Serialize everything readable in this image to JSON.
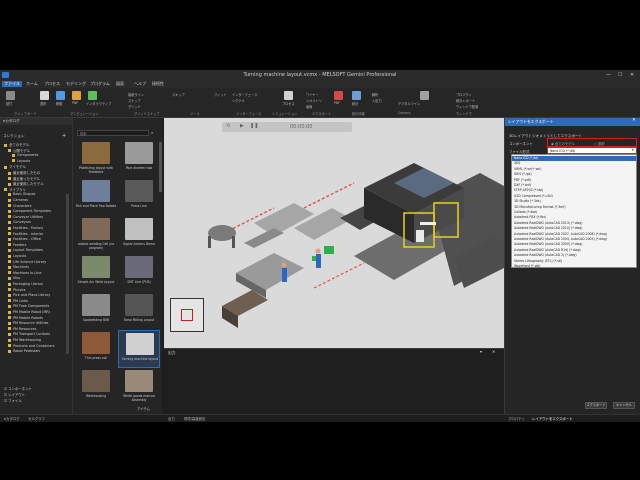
{
  "window": {
    "title": "Turning machine layout.vcmx - MELSOFT Gemini Professional"
  },
  "menu": [
    "ファイル",
    "ホーム",
    "プロセス",
    "モデリング",
    "プログラム",
    "図面",
    "ヘルプ",
    "接続性"
  ],
  "ribbon": {
    "groups": [
      "クリップボード",
      "マニピュレーション",
      "グリッドスナップ",
      "ツール",
      "インターフェース",
      "シミュレーション",
      "エクスポート",
      "統計情報",
      "Camera",
      "ウィンドウ"
    ],
    "items": [
      "貼付",
      "選択",
      "移動",
      "PNP",
      "インタラクティブ",
      "接続ライン",
      "スナップ",
      "グリッド",
      "スキップ",
      "インターフェース",
      "シグナル",
      "フィット",
      "プロセス",
      "ワイヤー",
      "ジオメトリ",
      "画像",
      "PDF",
      "統計",
      "解析",
      "入出力",
      "デジタルツイン",
      "エクスポート",
      "プロパティ",
      "統計レポート",
      "ウィンドウ配置"
    ]
  },
  "left_panel": {
    "title": "eカタログ",
    "collections_label": "コレクション",
    "tree": [
      "全てのモデル",
      "公開モデル",
      "Components",
      "Layouts",
      "マイモデル",
      "最近使用したもの",
      "最近使ったモデル",
      "最近使用したモデル",
      "ライブラリ",
      "Basic Shapes",
      "Cameras",
      "Characters",
      "Component Templates",
      "Conveyor Utilities",
      "Conveyors",
      "Facilities - Factory",
      "Facilities - Interior",
      "Facilities - Office",
      "Feeders",
      "Layout Templates",
      "Layouts",
      "Life Science Library",
      "Machines",
      "Machines In-Line",
      "Misc",
      "Packaging Library",
      "Physics",
      "Pick and Place Library",
      "PM Lines",
      "PM Flow Components",
      "PM Mobile Robot (MR)",
      "PM Mobile Robots",
      "PM Resource Utilities",
      "PM Resources",
      "PM Transport Controls",
      "PM Warehousing",
      "Products and Containers",
      "Robot Pedestals"
    ],
    "checkboxes": [
      "コンポーネント",
      "レイアウト",
      "ファイル"
    ]
  },
  "mid_panel": {
    "search_placeholder": "検索",
    "items": [
      "Palletizing layout with Feedback",
      "Pipe diverter tool",
      "Pick and Place Two Robots",
      "Press Line",
      "robotic welding Cell (no program)",
      "Signal Actions Demo",
      "Simple Arc Weld Layout",
      "SMT Line (PCB)",
      "Spotwelding BIW",
      "Tomo Milling Layout",
      "Thin press coil",
      "Turning machine layout",
      "Warehousing",
      "White goods manual Assembly"
    ],
    "footer_label": "アイテム"
  },
  "viewport": {
    "time": "00:00:00"
  },
  "output_panel": {
    "title": "出力"
  },
  "right_panel": {
    "title": "レイアウトをエクスポート",
    "subtitle": "3Dレイアウトジオメトリとしてエクスポート",
    "component_label": "コンポーネント",
    "radio_all": "全てのモデル",
    "radio_selected": "選択",
    "file_format_label": "ファイル形式",
    "file_format_value": "Nano ICD (*.jtd)",
    "formats": [
      "Nano ICD (*.jtd)",
      "3DS",
      "VRML (*.wrl;*.wrl)",
      "IGES (*.igs)",
      "PDF (*.pdf)",
      "DXF (*.dxf)",
      "STEP AP203 (*.stp)",
      "U3D Compressed (*.u3d)",
      "3D Studio (*.3ds)",
      "3D Manufacturing Format (*.3mf)",
      "Collada (*.dae)",
      "Autodesk FBX (*.fbx)",
      "Autodesk RealDWG (AutoCAD 2013) (*.dwg)",
      "Autodesk RealDWG (AutoCAD 2010) (*.dwg)",
      "Autodesk RealDWG (AutoCAD 2007, AutoCAD 2008) (*.dwg)",
      "Autodesk RealDWG (AutoCAD 2004, AutoCAD 2005) (*.dwg)",
      "Autodesk RealDWG (AutoCAD 2000) (*.dwg)",
      "Autodesk RealDWG (AutoCAD R14) (*.dwg)",
      "Autodesk RealDWG (AutoCAD 2) (*.dwg)",
      "Stereo Lithography (STL) (*.stl)",
      "Wavefront (*.obj)"
    ],
    "export_button": "エクスポート",
    "cancel_button": "キャンセル"
  },
  "statusbar": {
    "left_tabs": [
      "eカタログ",
      "セルグラフ"
    ],
    "mid_tabs": [
      "出力",
      "環境/高度設定"
    ],
    "right_tabs": [
      "プロパティ",
      "レイアウトをエクスポート"
    ]
  },
  "colors": {
    "accent": "#2d6bb3",
    "highlight_red": "#d21f1f",
    "floor": "#d9d9d9",
    "safety_yellow": "#e6d21a"
  }
}
